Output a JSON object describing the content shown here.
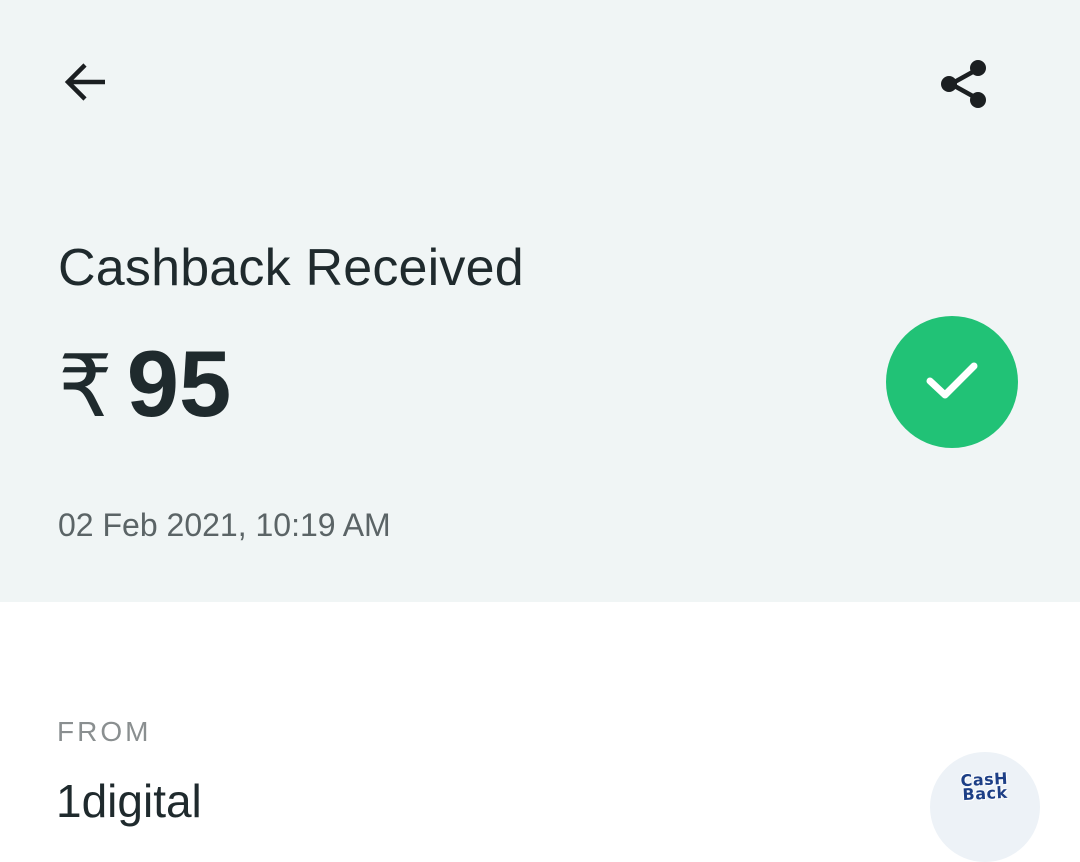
{
  "header": {
    "back_icon": "arrow-left-icon",
    "share_icon": "share-icon"
  },
  "transaction": {
    "title": "Cashback Received",
    "currency_symbol": "₹",
    "amount": "95",
    "datetime": "02 Feb 2021, 10:19 AM",
    "status_icon": "checkmark-icon",
    "status_color": "#21c276"
  },
  "source": {
    "label": "FROM",
    "name": "1digital",
    "logo_text_line1": "CasH",
    "logo_text_line2": "Back"
  },
  "colors": {
    "top_panel_bg": "#f0f5f5",
    "text_primary": "#1f2a2d",
    "text_secondary": "#5b6466",
    "label_gray": "#8a8f90"
  }
}
